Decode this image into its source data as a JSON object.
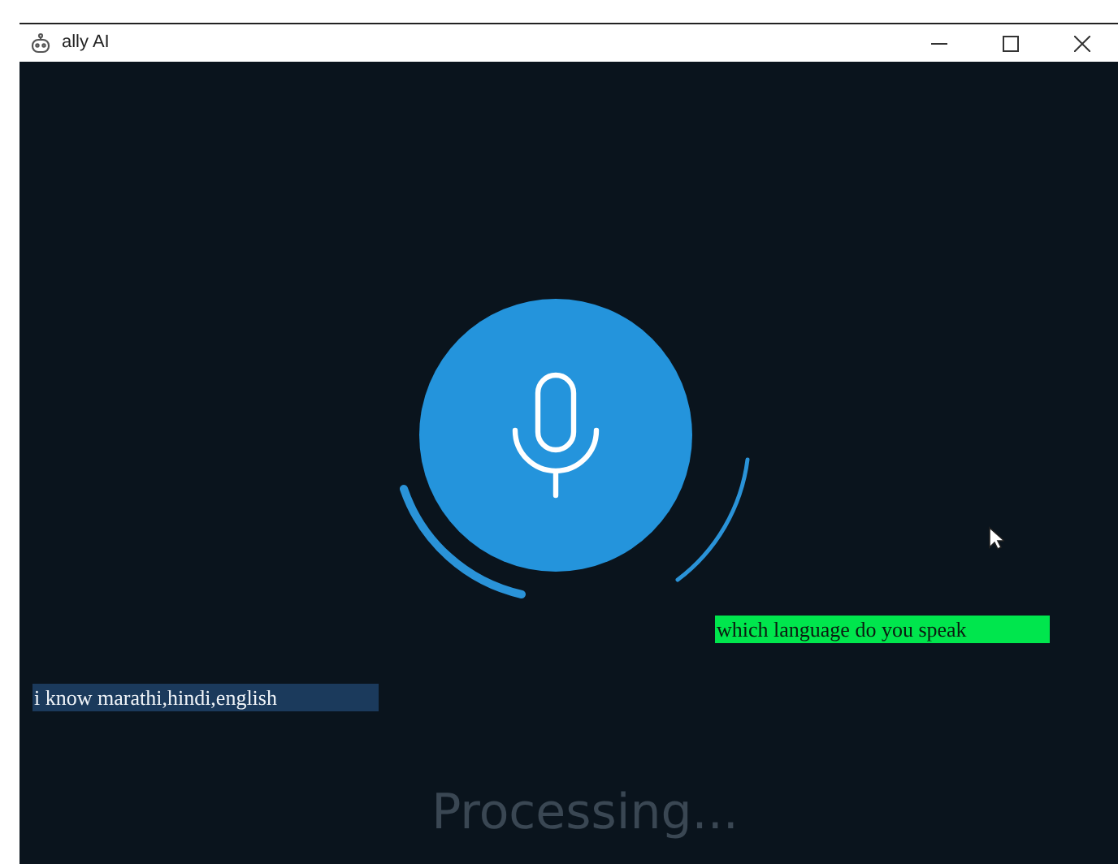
{
  "window": {
    "title": "ally AI"
  },
  "messages": [
    {
      "text": "which language do you speak",
      "kind": "question"
    },
    {
      "text": "i know marathi,hindi,english",
      "kind": "answer"
    }
  ],
  "status": "Processing..."
}
